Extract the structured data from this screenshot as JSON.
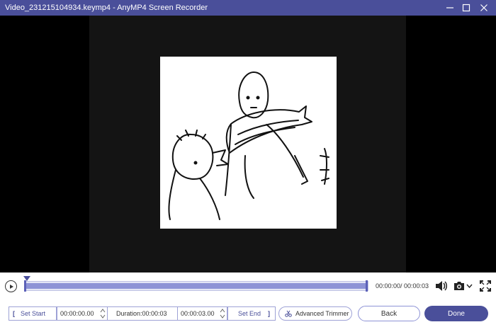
{
  "window": {
    "title": "Video_231215104934.keymp4  -  AnyMP4 Screen Recorder"
  },
  "colors": {
    "title_bar": "#4a4f9a",
    "accent": "#4a4f9a",
    "track_fill": "#8e93d6"
  },
  "timeline": {
    "time_readout": "00:00:00/ 00:00:03",
    "progress": 0.0
  },
  "trim": {
    "set_start_label": "Set Start",
    "start_value": "00:00:00.00",
    "duration_label": "Duration:00:00:03",
    "end_value": "00:00:03.00",
    "set_end_label": "Set End",
    "advanced_trimmer_label": "Advanced Trimmer"
  },
  "actions": {
    "back_label": "Back",
    "done_label": "Done"
  },
  "icons": [
    "play-icon",
    "volume-icon",
    "camera-icon",
    "chevron-down-icon",
    "fullscreen-icon",
    "minimize-icon",
    "maximize-icon",
    "close-icon",
    "scissors-icon"
  ]
}
